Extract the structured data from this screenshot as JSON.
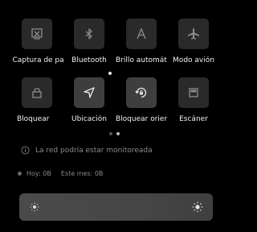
{
  "tiles": [
    {
      "label": "Captura de pantalla",
      "icon": "screenshot-icon",
      "active": false
    },
    {
      "label": "Bluetooth",
      "icon": "bluetooth-icon",
      "active": false
    },
    {
      "label": "Brillo automático",
      "icon": "auto-brightness-icon",
      "active": false
    },
    {
      "label": "Modo avión",
      "icon": "airplane-icon",
      "active": false
    },
    {
      "label": "Bloquear",
      "icon": "lock-icon",
      "active": false
    },
    {
      "label": "Ubicación",
      "icon": "location-icon",
      "active": true
    },
    {
      "label": "Bloquear orientación",
      "icon": "rotation-lock-icon",
      "active": true
    },
    {
      "label": "Escáner",
      "icon": "scanner-icon",
      "active": false
    }
  ],
  "pager": {
    "pages": 2,
    "current": 2
  },
  "network_warning": {
    "text": "La red podría estar monitoreada",
    "icon": "info-icon"
  },
  "data_usage": {
    "today": "Hoy: 0B",
    "month": "Este mes: 0B"
  },
  "brightness": {
    "level": 0.95,
    "min_icon": "sun-small-icon",
    "max_icon": "sun-large-icon"
  }
}
